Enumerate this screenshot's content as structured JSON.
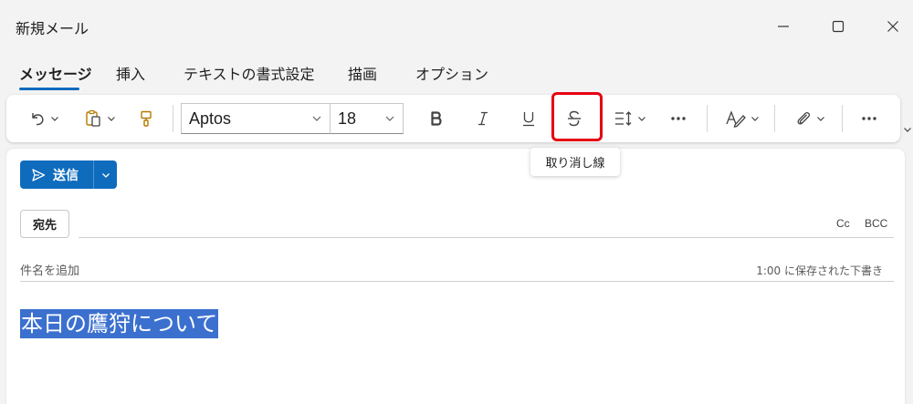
{
  "window": {
    "title": "新規メール",
    "controls": [
      "minimize-icon",
      "maximize-icon",
      "close-icon"
    ]
  },
  "tabs": [
    {
      "label": "メッセージ",
      "active": true
    },
    {
      "label": "挿入",
      "active": false
    },
    {
      "label": "テキストの書式設定",
      "active": false
    },
    {
      "label": "描画",
      "active": false
    },
    {
      "label": "オプション",
      "active": false
    }
  ],
  "ribbon": {
    "font_name": "Aptos",
    "font_size": "18",
    "buttons": [
      "undo-icon",
      "paste-icon",
      "format-painter-icon",
      "bold-icon",
      "italic-icon",
      "underline-icon",
      "strikethrough-icon",
      "line-spacing-icon",
      "more-icon",
      "editor-icon",
      "attach-icon",
      "more-icon"
    ],
    "highlighted": "strikethrough",
    "accent_color": "#0f6cbd",
    "highlight_color": "#e60012"
  },
  "tooltip": "取り消し線",
  "compose": {
    "send_label": "送信",
    "to_label": "宛先",
    "cc_label": "Cc",
    "bcc_label": "BCC",
    "subject_placeholder": "件名を追加",
    "saved_status": "1:00 に保存された下書き",
    "body_text": "本日の鷹狩について",
    "selection_color": "#3b70cf"
  }
}
